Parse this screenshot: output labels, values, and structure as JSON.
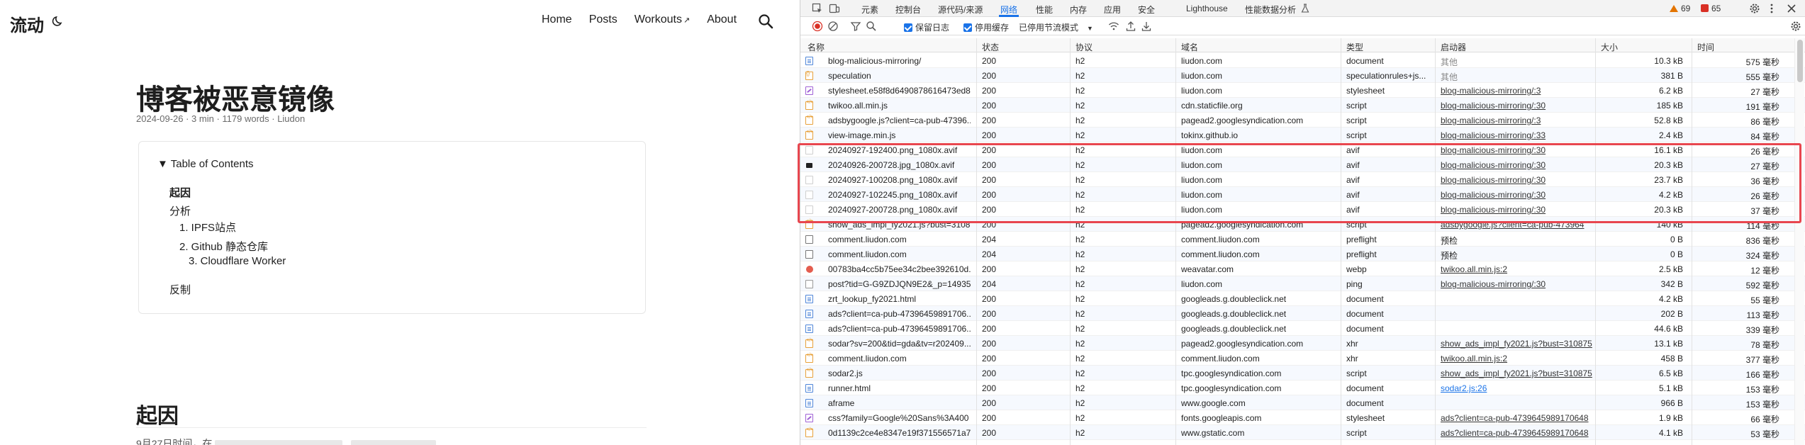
{
  "blog": {
    "brand": "流动",
    "nav": [
      {
        "label": "Home"
      },
      {
        "label": "Posts"
      },
      {
        "label": "Workouts"
      },
      {
        "label": "About"
      }
    ],
    "title": "博客被恶意镜像",
    "meta": "2024-09-26 · 3 min · 1179 words · Liudon",
    "toc": {
      "summary": "▼ Table of Contents",
      "items": [
        {
          "label": "起因"
        },
        {
          "label": "分析"
        },
        {
          "label": "1. IPFS站点"
        },
        {
          "label": "2. Github 静态仓库"
        },
        {
          "label": "3. Cloudflare Worker"
        },
        {
          "label": "反制"
        }
      ]
    },
    "section_heading": "起因",
    "partial_text": "9月27日时间，在"
  },
  "devtools": {
    "tabs": [
      "元素",
      "控制台",
      "源代码/来源",
      "网络",
      "性能",
      "内存",
      "应用",
      "安全",
      "Lighthouse",
      "性能数据分析"
    ],
    "active_tab": "网络",
    "warning_count": "69",
    "error_count": "65",
    "toolbar": {
      "preserve_log": "保留日志",
      "disable_cache": "停用缓存",
      "throttle": "已停用节流模式"
    },
    "columns": [
      "名称",
      "状态",
      "协议",
      "域名",
      "类型",
      "启动器",
      "大小",
      "时间"
    ],
    "rows": [
      {
        "icon": "doc",
        "name": "blog-malicious-mirroring/",
        "status": "200",
        "protocol": "h2",
        "domain": "liudon.com",
        "type": "document",
        "initiator": "其他",
        "initiator_style": "gray",
        "size": "10.3 kB",
        "time": "575 毫秒"
      },
      {
        "icon": "speculation",
        "name": "speculation",
        "status": "200",
        "protocol": "h2",
        "domain": "liudon.com",
        "type": "speculationrules+js...",
        "initiator": "其他",
        "initiator_style": "gray",
        "size": "381 B",
        "time": "555 毫秒"
      },
      {
        "icon": "css",
        "name": "stylesheet.e58f8d6490878616473ed8...",
        "status": "200",
        "protocol": "h2",
        "domain": "liudon.com",
        "type": "stylesheet",
        "initiator": "blog-malicious-mirroring/:3",
        "initiator_style": "link",
        "size": "6.2 kB",
        "time": "27 毫秒"
      },
      {
        "icon": "script",
        "name": "twikoo.all.min.js",
        "status": "200",
        "protocol": "h2",
        "domain": "cdn.staticfile.org",
        "type": "script",
        "initiator": "blog-malicious-mirroring/:30",
        "initiator_style": "link",
        "size": "185 kB",
        "time": "191 毫秒"
      },
      {
        "icon": "script",
        "name": "adsbygoogle.js?client=ca-pub-47396...",
        "status": "200",
        "protocol": "h2",
        "domain": "pagead2.googlesyndication.com",
        "type": "script",
        "initiator": "blog-malicious-mirroring/:3",
        "initiator_style": "link",
        "size": "52.8 kB",
        "time": "86 毫秒"
      },
      {
        "icon": "script",
        "name": "view-image.min.js",
        "status": "200",
        "protocol": "h2",
        "domain": "tokinx.github.io",
        "type": "script",
        "initiator": "blog-malicious-mirroring/:33",
        "initiator_style": "link",
        "size": "2.4 kB",
        "time": "84 毫秒"
      },
      {
        "icon": "img",
        "name": "20240927-192400.png_1080x.avif",
        "status": "200",
        "protocol": "h2",
        "domain": "liudon.com",
        "type": "avif",
        "initiator": "blog-malicious-mirroring/:30",
        "initiator_style": "link",
        "size": "16.1 kB",
        "time": "26 毫秒"
      },
      {
        "icon": "imgdark",
        "name": "20240926-200728.jpg_1080x.avif",
        "status": "200",
        "protocol": "h2",
        "domain": "liudon.com",
        "type": "avif",
        "initiator": "blog-malicious-mirroring/:30",
        "initiator_style": "link",
        "size": "20.3 kB",
        "time": "27 毫秒"
      },
      {
        "icon": "img",
        "name": "20240927-100208.png_1080x.avif",
        "status": "200",
        "protocol": "h2",
        "domain": "liudon.com",
        "type": "avif",
        "initiator": "blog-malicious-mirroring/:30",
        "initiator_style": "link",
        "size": "23.7 kB",
        "time": "36 毫秒"
      },
      {
        "icon": "img",
        "name": "20240927-102245.png_1080x.avif",
        "status": "200",
        "protocol": "h2",
        "domain": "liudon.com",
        "type": "avif",
        "initiator": "blog-malicious-mirroring/:30",
        "initiator_style": "link",
        "size": "4.2 kB",
        "time": "26 毫秒"
      },
      {
        "icon": "img",
        "name": "20240927-200728.png_1080x.avif",
        "status": "200",
        "protocol": "h2",
        "domain": "liudon.com",
        "type": "avif",
        "initiator": "blog-malicious-mirroring/:30",
        "initiator_style": "link",
        "size": "20.3 kB",
        "time": "37 毫秒"
      },
      {
        "icon": "script",
        "name": "show_ads_impl_fy2021.js?bust=3108...",
        "status": "200",
        "protocol": "h2",
        "domain": "pagead2.googlesyndication.com",
        "type": "script",
        "initiator": "adsbygoogle.js?client=ca-pub-473964",
        "initiator_style": "link",
        "size": "140 kB",
        "time": "114 毫秒"
      },
      {
        "icon": "empty",
        "name": "comment.liudon.com",
        "status": "204",
        "protocol": "h2",
        "domain": "comment.liudon.com",
        "type": "preflight",
        "initiator": "预检",
        "initiator_style": "plain",
        "size": "0 B",
        "time": "836 毫秒"
      },
      {
        "icon": "empty",
        "name": "comment.liudon.com",
        "status": "204",
        "protocol": "h2",
        "domain": "comment.liudon.com",
        "type": "preflight",
        "initiator": "预检",
        "initiator_style": "plain",
        "size": "0 B",
        "time": "324 毫秒"
      },
      {
        "icon": "webp",
        "name": "00783ba4cc5b75ee34c2bee392610d...",
        "status": "200",
        "protocol": "h2",
        "domain": "weavatar.com",
        "type": "webp",
        "initiator": "twikoo.all.min.js:2",
        "initiator_style": "link",
        "size": "2.5 kB",
        "time": "12 毫秒"
      },
      {
        "icon": "ping",
        "name": "post?tid=G-G9ZDJQN9E2&_p=14935...",
        "status": "204",
        "protocol": "h2",
        "domain": "liudon.com",
        "type": "ping",
        "initiator": "blog-malicious-mirroring/:30",
        "initiator_style": "link",
        "size": "342 B",
        "time": "592 毫秒"
      },
      {
        "icon": "doc",
        "name": "zrt_lookup_fy2021.html",
        "status": "200",
        "protocol": "h2",
        "domain": "googleads.g.doubleclick.net",
        "type": "document",
        "initiator": "",
        "initiator_style": "plain",
        "size": "4.2 kB",
        "time": "55 毫秒"
      },
      {
        "icon": "doc",
        "name": "ads?client=ca-pub-47396459891706...",
        "status": "200",
        "protocol": "h2",
        "domain": "googleads.g.doubleclick.net",
        "type": "document",
        "initiator": "",
        "initiator_style": "plain",
        "size": "202 B",
        "time": "113 毫秒"
      },
      {
        "icon": "doc",
        "name": "ads?client=ca-pub-47396459891706...",
        "status": "200",
        "protocol": "h2",
        "domain": "googleads.g.doubleclick.net",
        "type": "document",
        "initiator": "",
        "initiator_style": "plain",
        "size": "44.6 kB",
        "time": "339 毫秒"
      },
      {
        "icon": "script",
        "name": "sodar?sv=200&tid=gda&tv=r202409...",
        "status": "200",
        "protocol": "h2",
        "domain": "pagead2.googlesyndication.com",
        "type": "xhr",
        "initiator": "show_ads_impl_fy2021.js?bust=310875",
        "initiator_style": "link",
        "size": "13.1 kB",
        "time": "78 毫秒"
      },
      {
        "icon": "script",
        "name": "comment.liudon.com",
        "status": "200",
        "protocol": "h2",
        "domain": "comment.liudon.com",
        "type": "xhr",
        "initiator": "twikoo.all.min.js:2",
        "initiator_style": "link",
        "size": "458 B",
        "time": "377 毫秒"
      },
      {
        "icon": "script",
        "name": "sodar2.js",
        "status": "200",
        "protocol": "h2",
        "domain": "tpc.googlesyndication.com",
        "type": "script",
        "initiator": "show_ads_impl_fy2021.js?bust=310875",
        "initiator_style": "link",
        "size": "6.5 kB",
        "time": "166 毫秒"
      },
      {
        "icon": "doc",
        "name": "runner.html",
        "status": "200",
        "protocol": "h2",
        "domain": "tpc.googlesyndication.com",
        "type": "document",
        "initiator": "sodar2.js:26",
        "initiator_style": "blue",
        "size": "5.1 kB",
        "time": "153 毫秒"
      },
      {
        "icon": "doc",
        "name": "aframe",
        "status": "200",
        "protocol": "h2",
        "domain": "www.google.com",
        "type": "document",
        "initiator": "",
        "initiator_style": "plain",
        "size": "966 B",
        "time": "153 毫秒"
      },
      {
        "icon": "css",
        "name": "css?family=Google%20Sans%3A400",
        "status": "200",
        "protocol": "h2",
        "domain": "fonts.googleapis.com",
        "type": "stylesheet",
        "initiator": "ads?client=ca-pub-4739645989170648",
        "initiator_style": "link",
        "size": "1.9 kB",
        "time": "66 毫秒"
      },
      {
        "icon": "script",
        "name": "0d1139c2ce4e8347e19f371556571a7...",
        "status": "200",
        "protocol": "h2",
        "domain": "www.gstatic.com",
        "type": "script",
        "initiator": "ads?client=ca-pub-4739645989170648",
        "initiator_style": "link",
        "size": "4.1 kB",
        "time": "53 毫秒"
      }
    ]
  }
}
